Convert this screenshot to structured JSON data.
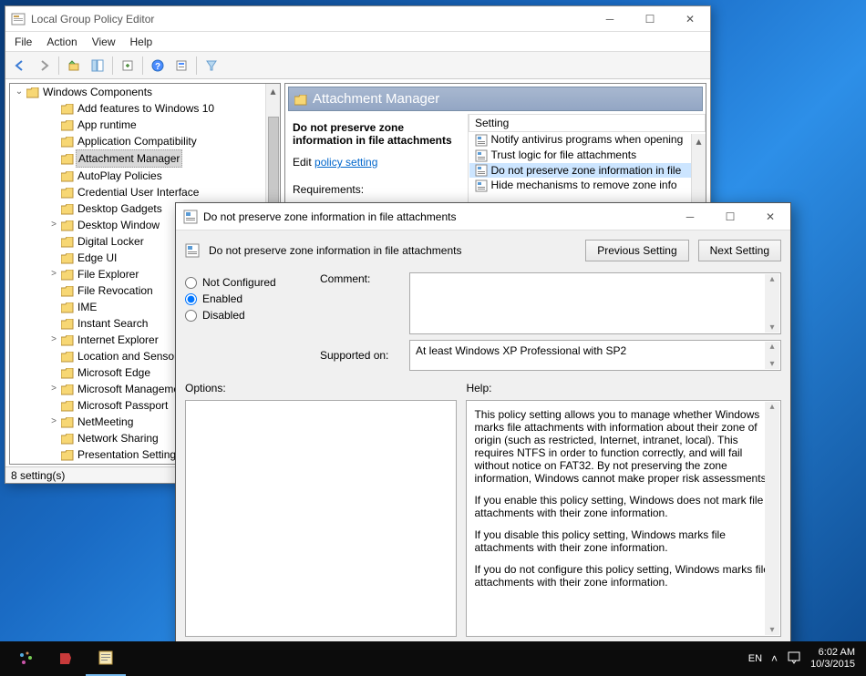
{
  "gpedit": {
    "title": "Local Group Policy Editor",
    "menubar": [
      "File",
      "Action",
      "View",
      "Help"
    ],
    "tree": {
      "root": "Windows Components",
      "items": [
        {
          "label": "Add features to Windows 10",
          "exp": ""
        },
        {
          "label": "App runtime",
          "exp": ""
        },
        {
          "label": "Application Compatibility",
          "exp": ""
        },
        {
          "label": "Attachment Manager",
          "exp": "",
          "selected": true
        },
        {
          "label": "AutoPlay Policies",
          "exp": ""
        },
        {
          "label": "Credential User Interface",
          "exp": ""
        },
        {
          "label": "Desktop Gadgets",
          "exp": ""
        },
        {
          "label": "Desktop Window",
          "exp": ">"
        },
        {
          "label": "Digital Locker",
          "exp": ""
        },
        {
          "label": "Edge UI",
          "exp": ""
        },
        {
          "label": "File Explorer",
          "exp": ">"
        },
        {
          "label": "File Revocation",
          "exp": ""
        },
        {
          "label": "IME",
          "exp": ""
        },
        {
          "label": "Instant Search",
          "exp": ""
        },
        {
          "label": "Internet Explorer",
          "exp": ">"
        },
        {
          "label": "Location and Sensors",
          "exp": ""
        },
        {
          "label": "Microsoft Edge",
          "exp": ""
        },
        {
          "label": "Microsoft Management",
          "exp": ">"
        },
        {
          "label": "Microsoft Passport",
          "exp": ""
        },
        {
          "label": "NetMeeting",
          "exp": ">"
        },
        {
          "label": "Network Sharing",
          "exp": ""
        },
        {
          "label": "Presentation Settings",
          "exp": ""
        }
      ]
    },
    "rightpane": {
      "header": "Attachment Manager",
      "policyTitle": "Do not preserve zone information in file attachments",
      "editLinkPre": "Edit ",
      "editLink": "policy setting",
      "reqLabel": "Requirements:",
      "colSetting": "Setting",
      "settings": [
        {
          "label": "Notify antivirus programs when opening",
          "selected": false
        },
        {
          "label": "Trust logic for file attachments",
          "selected": false
        },
        {
          "label": "Do not preserve zone information in file",
          "selected": true
        },
        {
          "label": "Hide mechanisms to remove zone info",
          "selected": false
        }
      ]
    },
    "status": "8 setting(s)"
  },
  "dialog": {
    "title": "Do not preserve zone information in file attachments",
    "subtitle": "Do not preserve zone information in file attachments",
    "prevBtn": "Previous Setting",
    "nextBtn": "Next Setting",
    "radioNC": "Not Configured",
    "radioEn": "Enabled",
    "radioDis": "Disabled",
    "commentLabel": "Comment:",
    "supportedLabel": "Supported on:",
    "supportedText": "At least Windows XP Professional with SP2",
    "optionsLabel": "Options:",
    "helpLabel": "Help:",
    "helpText1": "This policy setting allows you to manage whether Windows marks file attachments with information about their zone of origin (such as restricted, Internet, intranet, local). This requires NTFS in order to function correctly, and will fail without notice on FAT32. By not preserving the zone information, Windows cannot make proper risk assessments.",
    "helpText2": "If you enable this policy setting, Windows does not mark file attachments with their zone information.",
    "helpText3": "If you disable this policy setting, Windows marks file attachments with their zone information.",
    "helpText4": "If you do not configure this policy setting, Windows marks file attachments with their zone information."
  },
  "taskbar": {
    "lang": "EN",
    "time": "6:02 AM",
    "date": "10/3/2015"
  }
}
